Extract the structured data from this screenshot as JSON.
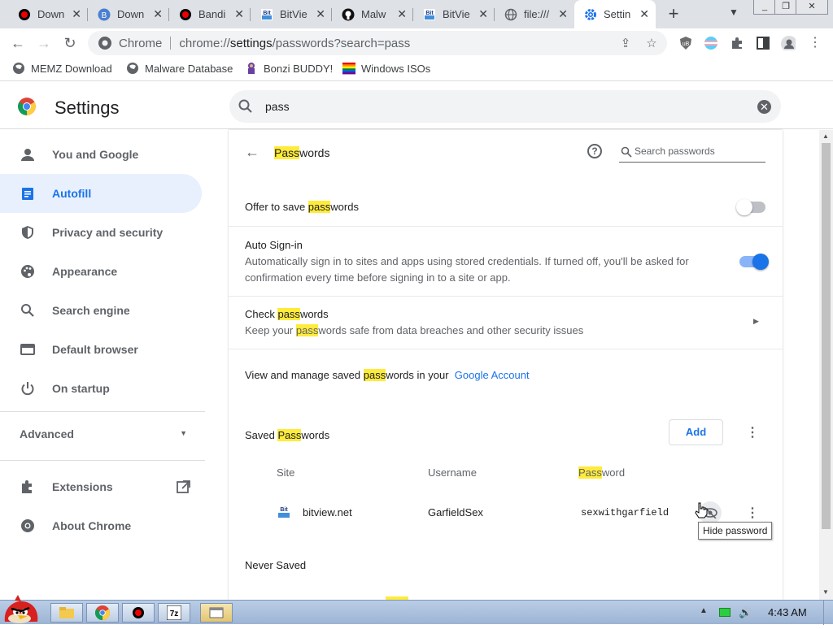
{
  "tabs": [
    {
      "title": "Down",
      "icon": "record-icon"
    },
    {
      "title": "Down",
      "icon": "b-icon"
    },
    {
      "title": "Bandi",
      "icon": "record-icon"
    },
    {
      "title": "BitVie",
      "icon": "bitview-icon"
    },
    {
      "title": "Malw",
      "icon": "github-icon"
    },
    {
      "title": "BitVie",
      "icon": "bitview-icon"
    },
    {
      "title": "file:///",
      "icon": "globe-icon"
    },
    {
      "title": "Settin",
      "icon": "gear-icon"
    }
  ],
  "omnibox": {
    "site": "Chrome",
    "url_prefix": "chrome://",
    "url_main": "settings",
    "url_rest": "/passwords?search=pass"
  },
  "bookmarks": [
    "MEMZ Download",
    "Malware Database",
    "Bonzi BUDDY!",
    "Windows ISOs"
  ],
  "header": {
    "title": "Settings",
    "search_value": "pass"
  },
  "sidebar": {
    "items": [
      "You and Google",
      "Autofill",
      "Privacy and security",
      "Appearance",
      "Search engine",
      "Default browser",
      "On startup"
    ],
    "advanced": "Advanced",
    "extensions": "Extensions",
    "about": "About Chrome"
  },
  "passwords": {
    "title_hl": "Pass",
    "title_rest": "words",
    "search_placeholder": "Search passwords",
    "offer_pre": "Offer to save ",
    "offer_hl": "pass",
    "offer_post": "words",
    "offer_enabled": false,
    "autosignin_title": "Auto Sign-in",
    "autosignin_desc": "Automatically sign in to sites and apps using stored credentials. If turned off, you'll be asked for confirmation every time before signing in to a site or app.",
    "autosignin_enabled": true,
    "check_pre": "Check ",
    "check_hl": "pass",
    "check_post": "words",
    "check_sub_pre": "Keep your ",
    "check_sub_hl": "pass",
    "check_sub_post": "words safe from data breaches and other security issues",
    "manage_pre": "View and manage saved ",
    "manage_hl": "pass",
    "manage_post": "words in your",
    "manage_link": "Google Account",
    "saved_pre": "Saved ",
    "saved_hl": "Pass",
    "saved_post": "words",
    "add_label": "Add",
    "col_site": "Site",
    "col_username": "Username",
    "col_password_hl": "Pass",
    "col_password_post": "word",
    "entries": [
      {
        "site": "bitview.net",
        "username": "GarfieldSex",
        "password": "sexwithgarfield"
      }
    ],
    "tooltip": "Hide password",
    "never_saved": "Never Saved"
  },
  "taskbar": {
    "clock": "4:43 AM"
  }
}
